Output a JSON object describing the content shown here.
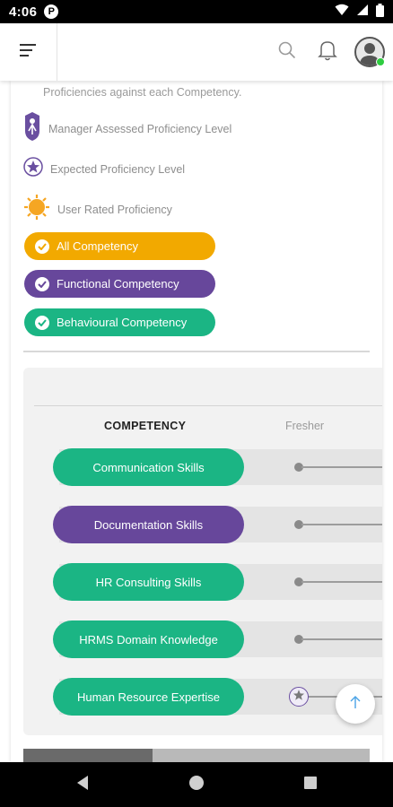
{
  "status_bar": {
    "time": "4:06",
    "app_badge": "P"
  },
  "intro_text": "Proficiencies against each Competency.",
  "legend": [
    {
      "label": "Manager Assessed Proficiency Level",
      "icon": "manager-person-icon",
      "color": "#6a4fa0"
    },
    {
      "label": "Expected Proficiency Level",
      "icon": "star-icon",
      "color": "#6a4fa0"
    },
    {
      "label": "User Rated Proficiency",
      "icon": "sun-icon",
      "color": "#f5a623"
    }
  ],
  "filters": [
    {
      "label": "All Competency",
      "color": "#f2a900"
    },
    {
      "label": "Functional Competency",
      "color": "#67479b"
    },
    {
      "label": "Behavioural Competency",
      "color": "#1bb584"
    }
  ],
  "table": {
    "competency_header": "COMPETENCY",
    "level_header": "Fresher",
    "rows": [
      {
        "name": "Communication Skills",
        "color": "#1bb584",
        "marker": "dot"
      },
      {
        "name": "Documentation Skills",
        "color": "#67479b",
        "marker": "dot"
      },
      {
        "name": "HR Consulting Skills",
        "color": "#1bb584",
        "marker": "dot"
      },
      {
        "name": "HRMS Domain Knowledge",
        "color": "#1bb584",
        "marker": "dot"
      },
      {
        "name": "Human Resource Expertise",
        "color": "#1bb584",
        "marker": "star"
      }
    ]
  },
  "icons": {
    "menu": "menu-icon",
    "search": "search-icon",
    "notifications": "bell-icon",
    "avatar": "avatar-icon",
    "scroll_top": "arrow-up-icon"
  },
  "colors": {
    "green": "#1bb584",
    "purple": "#67479b",
    "amber": "#f2a900",
    "fab_arrow": "#4aa3e6"
  }
}
